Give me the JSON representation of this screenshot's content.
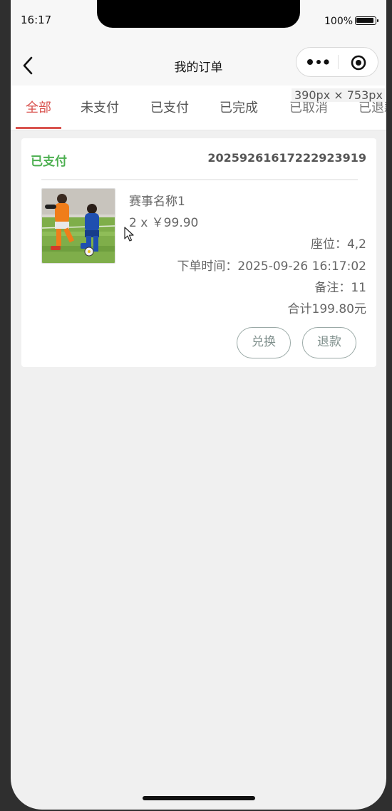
{
  "status_bar": {
    "time": "16:17",
    "battery": "100%"
  },
  "nav": {
    "title": "我的订单"
  },
  "tabs": [
    "全部",
    "未支付",
    "已支付",
    "已完成",
    "已取消",
    "已退款"
  ],
  "overlay": {
    "size_label": "390px × 753px"
  },
  "order": {
    "status": "已支付",
    "order_number": "20259261617222923919",
    "event_name": "赛事名称1",
    "quantity_price": "2 x ￥99.90",
    "seat": "座位：4,2",
    "order_time": "下单时间：2025-09-26 16:17:02",
    "note": "备注：11",
    "total": "合计199.80元",
    "buttons": {
      "exchange": "兑换",
      "refund": "退款"
    }
  },
  "colors": {
    "accent": "#d9534f",
    "paid_status": "#4caf50",
    "button_border": "#9aa9a6"
  }
}
